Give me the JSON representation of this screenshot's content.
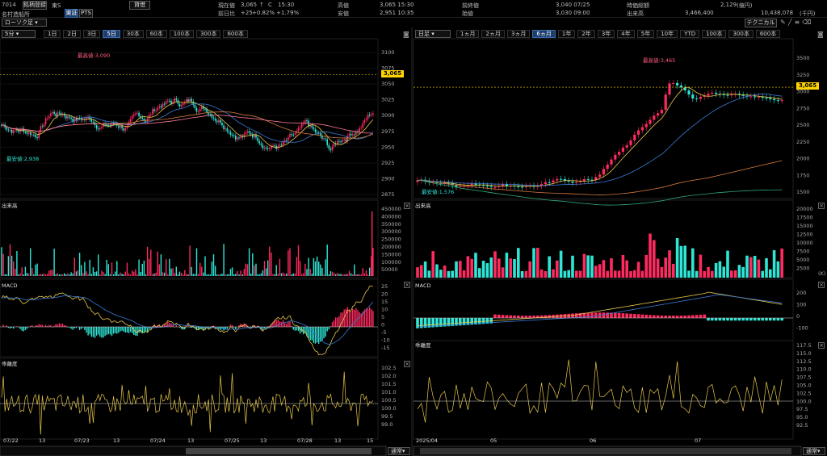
{
  "header": {
    "code": "7014",
    "register_btn": "銘柄登録",
    "market": "東S",
    "tab_tosho": "東証",
    "tab_pts": "PTS",
    "margin_btn": "貸借",
    "company": "名村造船所",
    "select_label": "ローソク足",
    "current_label": "現在値",
    "current_value": "3,065",
    "current_c": "C",
    "current_time": "15:30",
    "prev_label": "前日比",
    "prev_change": "+25",
    "prev_change_pct": "+0.82%",
    "prev_change_pct2": "+1.79%",
    "high_label": "高値",
    "high_value": "3,065 15:30",
    "low_label": "安値",
    "low_value": "2,951 10:35",
    "prevclose_label": "前終値",
    "prevclose_value": "3,040 07/25",
    "open_label": "始値",
    "open_value": "3,030 09:00",
    "mcap_label": "時価総額",
    "mcap_value": "2,129",
    "mcap_unit": "(億円)",
    "vol_label": "出来高",
    "vol_value": "3,466,400",
    "turnover_value": "10,438,078",
    "turnover_unit": "(千円)",
    "technical_btn": "テクニカル"
  },
  "left": {
    "interval": "5分",
    "periods": [
      "1日",
      "2日",
      "3日",
      "5日",
      "30本",
      "60本",
      "100本",
      "300本",
      "600本"
    ],
    "selected_period": "5日",
    "price_tag": "3,065",
    "high_label": "最高値:3,090",
    "low_label": "最安値:2,938",
    "y_labels": [
      "3100",
      "3075",
      "3050",
      "3025",
      "3000",
      "2975",
      "2950",
      "2925",
      "2900",
      "2875"
    ],
    "volume_title": "出来高",
    "vol_labels": [
      "450000",
      "400000",
      "350000",
      "300000",
      "250000",
      "200000",
      "150000",
      "100000",
      "50000"
    ],
    "macd_title": "MACD",
    "macd_labels": [
      "25",
      "20",
      "15",
      "10",
      "5",
      "0",
      "-5",
      "-10",
      "-15"
    ],
    "dev_title": "乖離度",
    "dev_labels": [
      "102.5",
      "102.0",
      "101.5",
      "101.0",
      "100.5",
      "100.0",
      "99.5",
      "99.0"
    ],
    "x_labels": [
      "07/22",
      "13",
      "07/23",
      "13",
      "07/24",
      "13",
      "07/25",
      "13",
      "07/28",
      "13",
      "15"
    ],
    "footer_select": "通常"
  },
  "right": {
    "interval": "日足",
    "periods": [
      "1ヵ月",
      "2ヵ月",
      "3ヵ月",
      "6ヵ月",
      "1年",
      "2年",
      "3年",
      "4年",
      "5年",
      "10年",
      "YTD",
      "100本",
      "300本",
      "600本"
    ],
    "selected_period": "6ヵ月",
    "price_tag": "3,065",
    "high_label": "最高値:3,465",
    "low_label": "最安値:1,576",
    "y_labels": [
      "3500",
      "3250",
      "3000",
      "2750",
      "2500",
      "2250",
      "2000",
      "1750",
      "1500"
    ],
    "volume_title": "出来高",
    "vol_labels": [
      "20000",
      "17500",
      "15000",
      "12500",
      "10000",
      "7500",
      "5000",
      "2500"
    ],
    "vol_unit": "(K)",
    "macd_title": "MACD",
    "macd_labels": [
      "200",
      "100",
      "0",
      "-100"
    ],
    "dev_title": "乖離度",
    "dev_labels": [
      "117.5",
      "115.0",
      "112.5",
      "110.0",
      "107.5",
      "105.0",
      "102.5",
      "100.0",
      "97.5",
      "95.0",
      "92.5"
    ],
    "x_labels": [
      "2025/04",
      "05",
      "06",
      "07"
    ],
    "footer_select": "通常"
  },
  "colors": {
    "up": "#ff2a5f",
    "down": "#2ee6d6",
    "accent": "#ffd400",
    "macd": "#e8c84a",
    "signal": "#3a7bd5"
  }
}
